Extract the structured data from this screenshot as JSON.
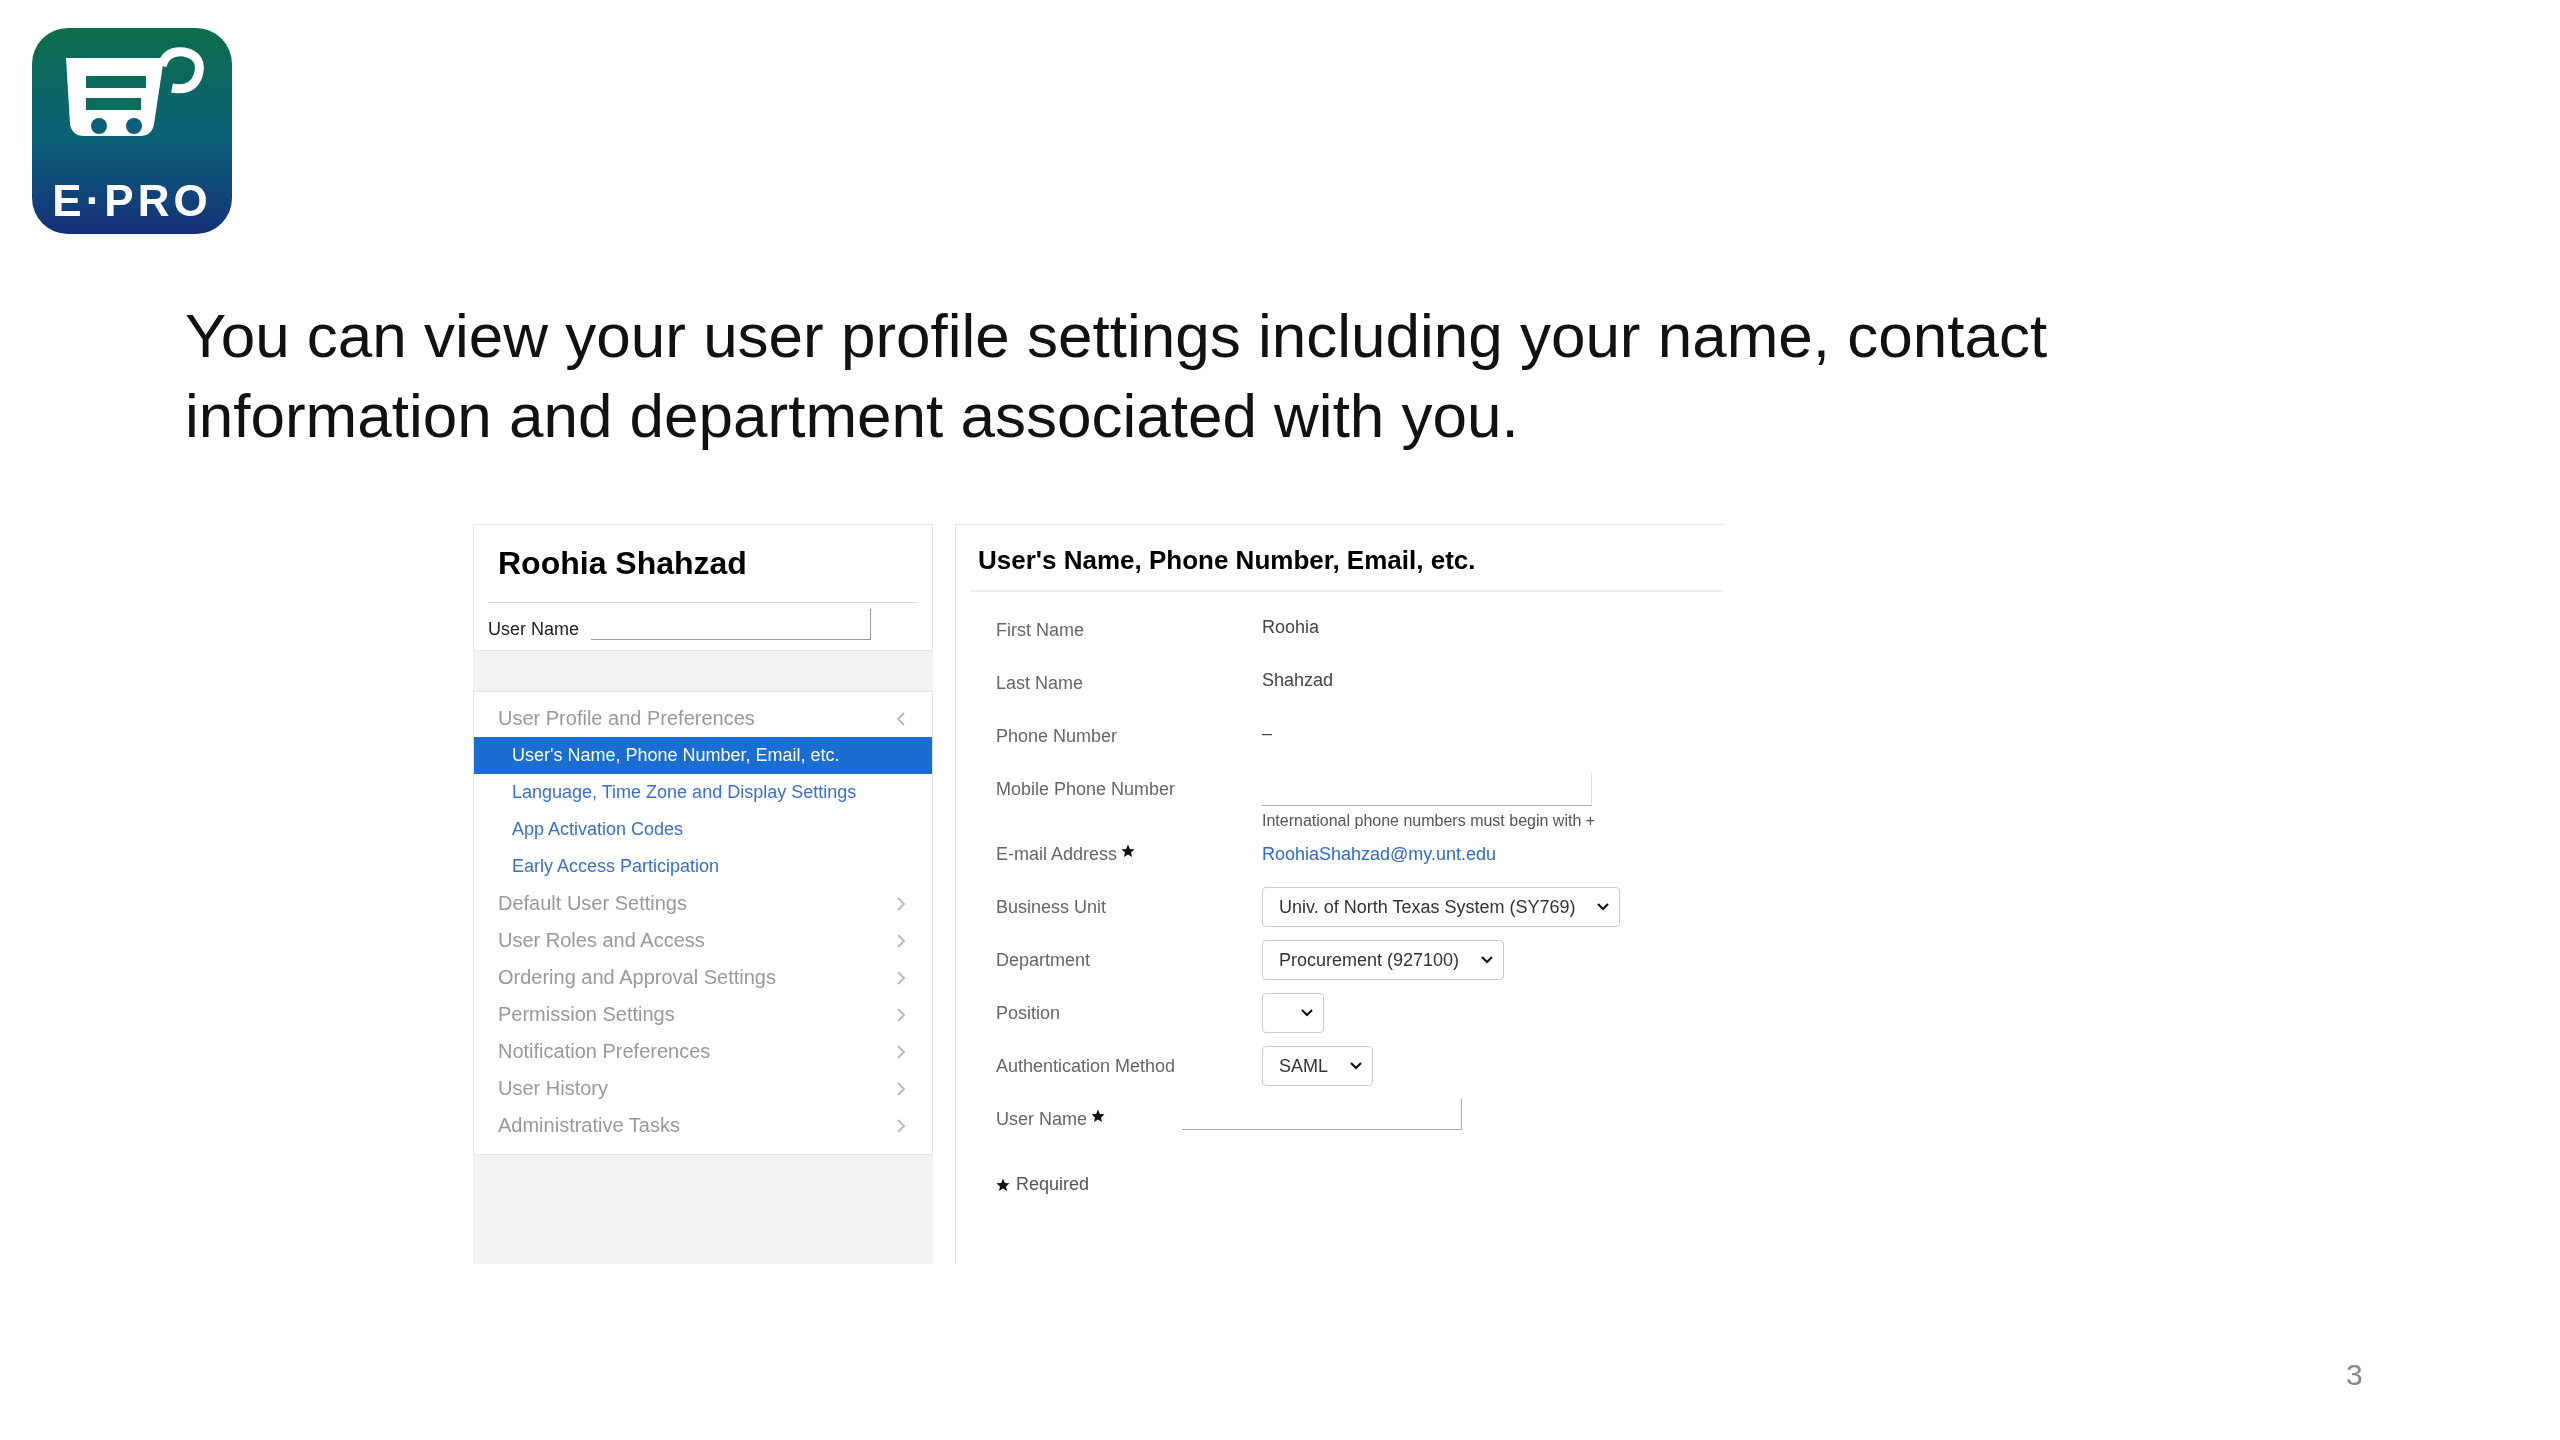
{
  "logo": {
    "text": "E·PRO"
  },
  "heading": "You can view your user profile settings including your name, contact information and department associated with you.",
  "profile": {
    "name": "Roohia Shahzad",
    "user_name_label": "User Name"
  },
  "nav": [
    {
      "label": "User Profile and Preferences",
      "expanded": true,
      "children": [
        {
          "label": "User's Name, Phone Number, Email, etc.",
          "selected": true
        },
        {
          "label": "Language, Time Zone and Display Settings",
          "selected": false
        },
        {
          "label": "App Activation Codes",
          "selected": false
        },
        {
          "label": "Early Access Participation",
          "selected": false
        }
      ]
    },
    {
      "label": "Default User Settings",
      "expanded": false
    },
    {
      "label": "User Roles and Access",
      "expanded": false
    },
    {
      "label": "Ordering and Approval Settings",
      "expanded": false
    },
    {
      "label": "Permission Settings",
      "expanded": false
    },
    {
      "label": "Notification Preferences",
      "expanded": false
    },
    {
      "label": "User History",
      "expanded": false
    },
    {
      "label": "Administrative Tasks",
      "expanded": false
    }
  ],
  "form": {
    "title": "User's Name, Phone Number, Email, etc.",
    "fields": [
      {
        "label": "First Name",
        "kind": "text",
        "value": "Roohia",
        "required": false
      },
      {
        "label": "Last Name",
        "kind": "text",
        "value": "Shahzad",
        "required": false
      },
      {
        "label": "Phone Number",
        "kind": "text",
        "value": "–",
        "required": false
      },
      {
        "label": "Mobile Phone Number",
        "kind": "input",
        "hint": "International phone numbers must begin with +",
        "required": false
      },
      {
        "label": "E-mail Address",
        "kind": "link",
        "value": "RoohiaShahzad@my.unt.edu",
        "required": true
      },
      {
        "label": "Business Unit",
        "kind": "select",
        "value": "Univ. of North Texas System (SY769)",
        "required": false
      },
      {
        "label": "Department",
        "kind": "select",
        "value": "Procurement (927100)",
        "required": false
      },
      {
        "label": "Position",
        "kind": "select",
        "required": false
      },
      {
        "label": "Authentication Method",
        "kind": "select",
        "value": "SAML",
        "required": false
      },
      {
        "label": "User Name",
        "kind": "input",
        "required": true
      }
    ],
    "required_note": "Required"
  },
  "page_number": "3"
}
